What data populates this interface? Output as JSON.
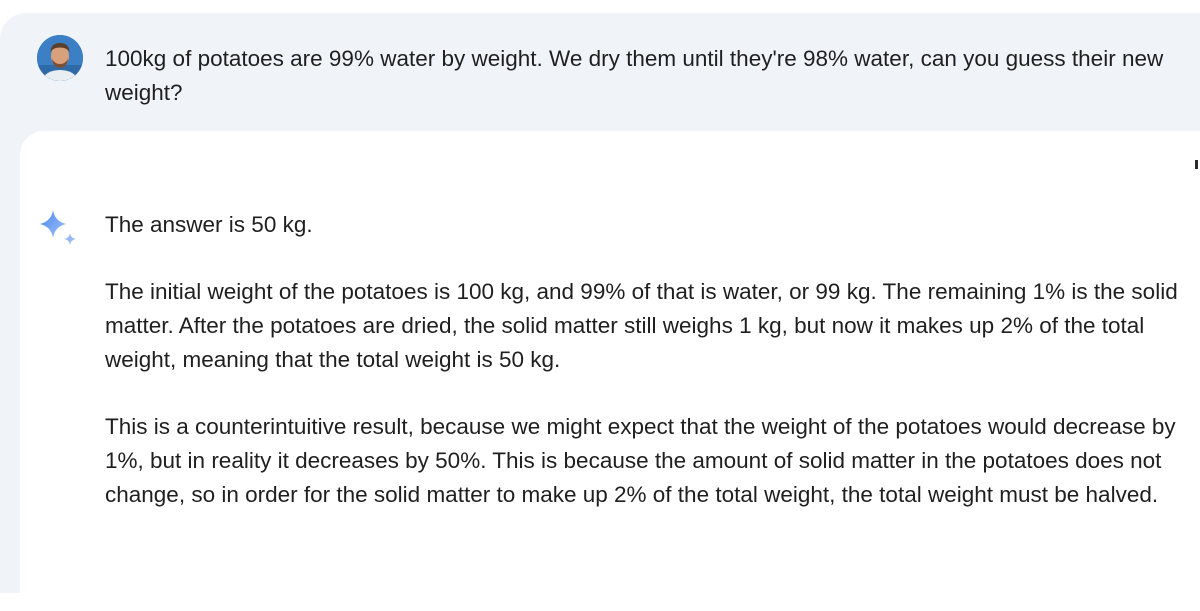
{
  "conversation": {
    "user": {
      "avatar": "user-avatar-photo",
      "message": "100kg of potatoes are 99% water by weight. We dry them until they're 98% water, can you guess their new weight?"
    },
    "response": {
      "icon": "gemini-sparkle-icon",
      "paragraphs": [
        "The answer is 50 kg.",
        "The initial weight of the potatoes is 100 kg, and 99% of that is water, or 99 kg. The remaining 1% is the solid matter. After the potatoes are dried, the solid matter still weighs 1 kg, but now it makes up 2% of the total weight, meaning that the total weight is 50 kg.",
        "This is a counterintuitive result, because we might expect that the weight of the potatoes would decrease by 1%, but in reality it decreases by 50%. This is because the amount of solid matter in the potatoes does not change, so in order for the solid matter to make up 2% of the total weight, the total weight must be halved."
      ]
    }
  },
  "colors": {
    "prompt_background": "#f0f4f9",
    "response_background": "#ffffff",
    "text": "#1f1f1f",
    "sparkle_start": "#4285f4",
    "sparkle_end": "#a7c4f5"
  }
}
